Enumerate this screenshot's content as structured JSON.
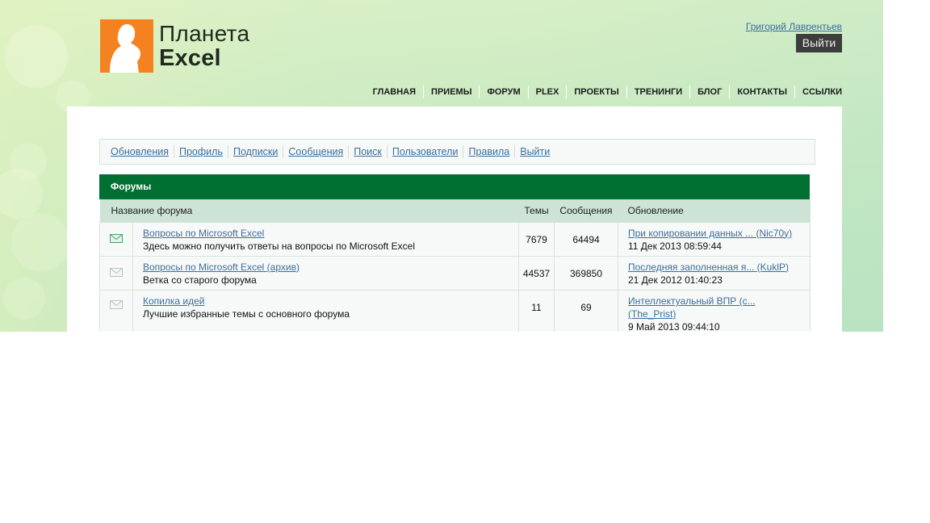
{
  "site": {
    "brand_line1": "Планета",
    "brand_line2": "Excel",
    "user_name": "Григорий Лаврентьев",
    "logout_button": "Выйти",
    "colors": {
      "accent_green": "#006f32",
      "logo_orange": "#f58220",
      "link_blue": "#3b6e9b"
    }
  },
  "topnav": [
    "ГЛАВНАЯ",
    "ПРИЕМЫ",
    "ФОРУМ",
    "PLEX",
    "ПРОЕКТЫ",
    "ТРЕНИНГИ",
    "БЛОГ",
    "КОНТАКТЫ",
    "ССЫЛКИ"
  ],
  "subnav": [
    "Обновления",
    "Профиль",
    "Подписки",
    "Сообщения",
    "Поиск",
    "Пользователи",
    "Правила",
    "Выйти"
  ],
  "forums": {
    "title": "Форумы",
    "columns": {
      "name": "Название форума",
      "topics": "Темы",
      "posts": "Сообщения",
      "updated": "Обновление"
    },
    "rows": [
      {
        "icon": "envelope-new-icon",
        "name": "Вопросы по Microsoft Excel",
        "description": "Здесь можно получить ответы на вопросы по Microsoft Excel",
        "topics": "7679",
        "posts": "64494",
        "last_topic": "При копировании данных ... (Nic70y)",
        "last_topic_2": "",
        "last_date": "11 Дек 2013 08:59:44"
      },
      {
        "icon": "envelope-read-icon",
        "name": "Вопросы по Microsoft Excel (архив)",
        "description": "Ветка со старого форума",
        "topics": "44537",
        "posts": "369850",
        "last_topic": "Последняя заполненная я... (KuklP)",
        "last_topic_2": "",
        "last_date": "21 Дек 2012 01:40:23"
      },
      {
        "icon": "envelope-read-icon",
        "name": "Копилка идей",
        "description": "Лучшие избранные темы с основного форума",
        "topics": "11",
        "posts": "69",
        "last_topic": "Интеллектуальный ВПР (с...",
        "last_topic_2": "(The_Prist)",
        "last_date": "9 Май 2013 09:44:10"
      }
    ]
  }
}
